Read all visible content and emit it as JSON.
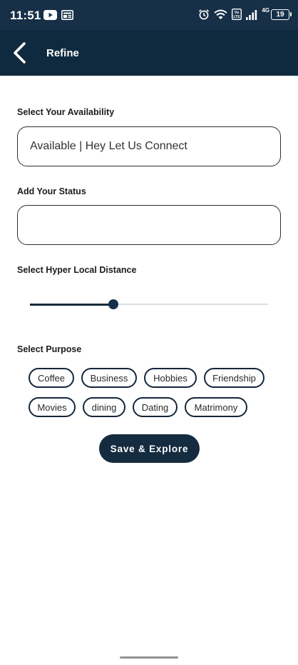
{
  "status_bar": {
    "time": "11:51",
    "network": "4G",
    "vo_lte": "Vo LTE",
    "battery": "19",
    "icons": [
      "youtube-icon",
      "news-icon",
      "alarm-icon",
      "wifi-icon",
      "volte-icon",
      "signal-icon",
      "battery-icon"
    ]
  },
  "app_bar": {
    "title": "Refine",
    "back_icon": "back-arrow-icon"
  },
  "availability": {
    "label": "Select Your Availability",
    "value": "Available | Hey Let Us Connect"
  },
  "status_field": {
    "label": "Add Your Status",
    "value": ""
  },
  "distance": {
    "label": "Select Hyper Local Distance",
    "slider_value_fraction": 0.35
  },
  "purpose": {
    "label": "Select Purpose",
    "row1": [
      "Coffee",
      "Business",
      "Hobbies",
      "Friendship"
    ],
    "row2": [
      "Movies",
      "dining",
      "Dating",
      "Matrimony"
    ]
  },
  "save_button": "Save & Explore",
  "colors": {
    "header": "#0f2a3e",
    "status_bar": "#173047",
    "accent": "#142b40"
  }
}
